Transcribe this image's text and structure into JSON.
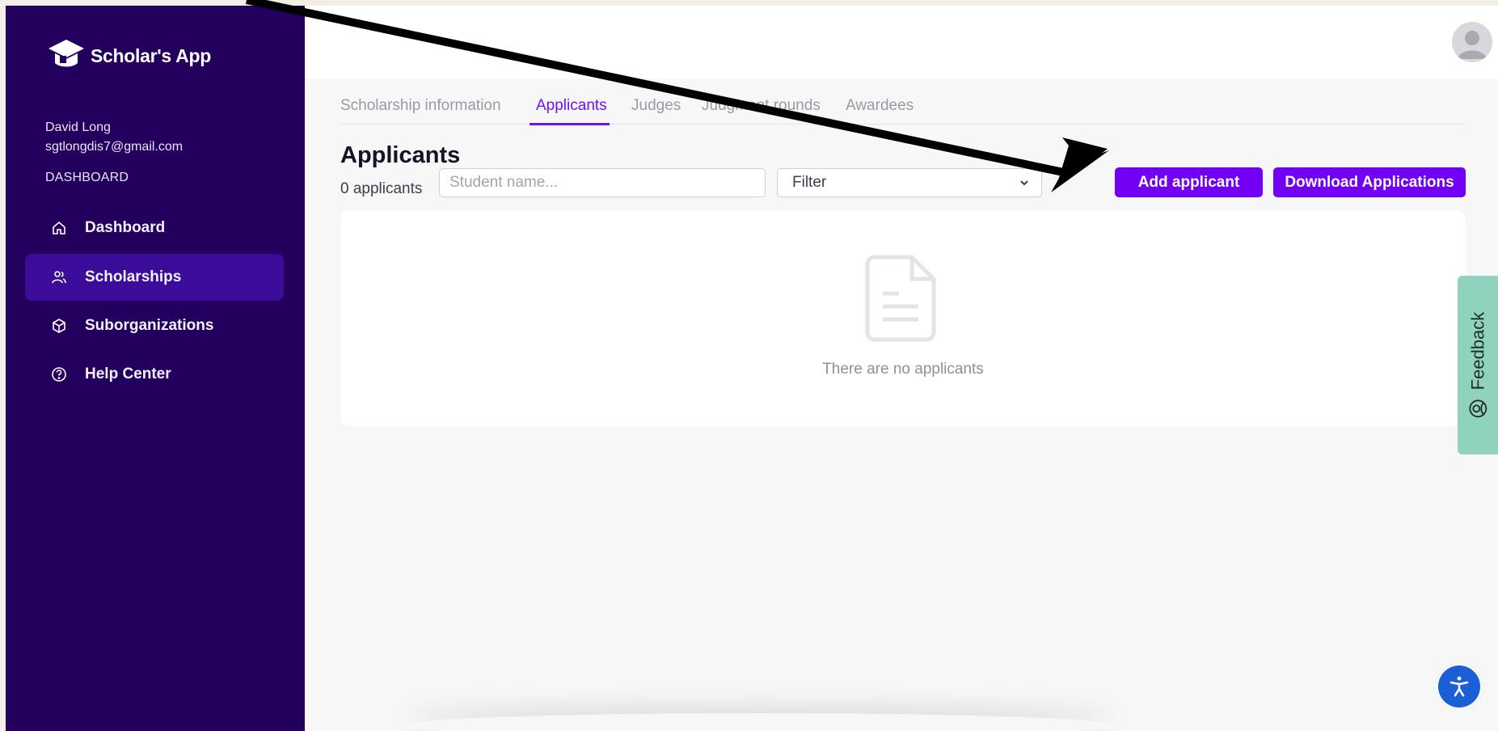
{
  "app": {
    "name": "Scholar's App"
  },
  "user": {
    "name": "David Long",
    "email": "sgtlongdis7@gmail.com"
  },
  "sidebar": {
    "section_label": "DASHBOARD",
    "items": [
      {
        "label": "Dashboard",
        "icon": "home-icon",
        "active": false
      },
      {
        "label": "Scholarships",
        "icon": "users-icon",
        "active": true
      },
      {
        "label": "Suborganizations",
        "icon": "cube-icon",
        "active": false
      },
      {
        "label": "Help Center",
        "icon": "help-circle-icon",
        "active": false
      }
    ]
  },
  "tabs": [
    {
      "label": "Scholarship information",
      "active": false
    },
    {
      "label": "Applicants",
      "active": true
    },
    {
      "label": "Judges",
      "active": false
    },
    {
      "label": "Judgment rounds",
      "active": false
    },
    {
      "label": "Awardees",
      "active": false
    }
  ],
  "main": {
    "title": "Applicants",
    "count_text": "0 applicants",
    "search_placeholder": "Student name...",
    "filter_label": "Filter",
    "add_button": "Add applicant",
    "download_button": "Download Applications",
    "empty_text": "There are no applicants"
  },
  "feedback": {
    "label": "Feedback"
  },
  "colors": {
    "sidebar": "#24005e",
    "accent": "#7100f5",
    "feedback": "#8fd3bf",
    "accessibility": "#1a5fd6"
  }
}
